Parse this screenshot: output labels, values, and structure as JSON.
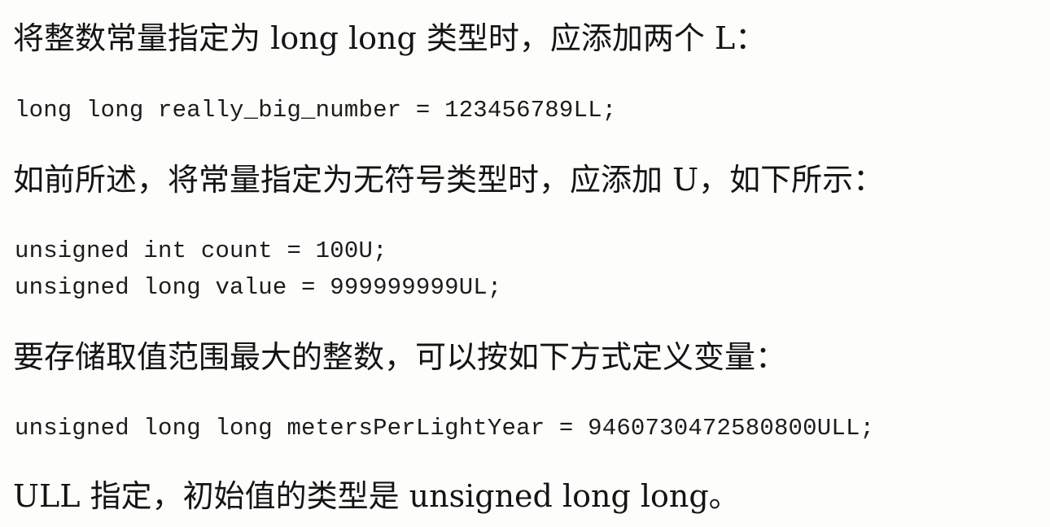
{
  "document": {
    "paragraphs": [
      "将整数常量指定为 long long 类型时，应添加两个 L：",
      "如前所述，将常量指定为无符号类型时，应添加 U，如下所示：",
      "要存储取值范围最大的整数，可以按如下方式定义变量：",
      "ULL 指定，初始值的类型是 unsigned long long。"
    ],
    "code_lines": [
      "long long really_big_number = 123456789LL;",
      "unsigned int count = 100U;",
      "unsigned long value = 999999999UL;",
      "unsigned long long metersPerLightYear = 9460730472580800ULL;"
    ]
  }
}
